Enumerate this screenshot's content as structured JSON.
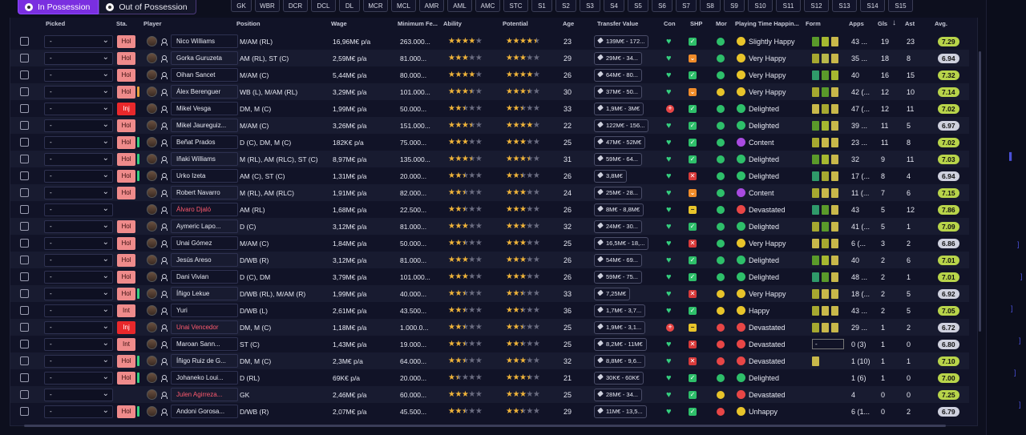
{
  "tabs": [
    {
      "label": "In Possession",
      "active": true
    },
    {
      "label": "Out of Possession",
      "active": false
    }
  ],
  "positions": [
    "GK",
    "WBR",
    "DCR",
    "DCL",
    "DL",
    "MCR",
    "MCL",
    "AMR",
    "AML",
    "AMC",
    "STC",
    "S1",
    "S2",
    "S3",
    "S4",
    "S5",
    "S6",
    "S7",
    "S8",
    "S9",
    "S10",
    "S11",
    "S12",
    "S13",
    "S14",
    "S15"
  ],
  "columns": {
    "picked": "Picked",
    "sta": "Sta.",
    "player": "Player",
    "position": "Position",
    "wage": "Wage",
    "minfee": "Minimum Fe...",
    "ability": "Ability",
    "potential": "Potential",
    "age": "Age",
    "tv": "Transfer Value",
    "con": "Con",
    "shp": "SHP",
    "mor": "Mor",
    "pth": "Playing Time Happin...",
    "form": "Form",
    "apps": "Apps",
    "gls": "Gls",
    "sort": "↓",
    "ast": "Ast",
    "avg": "Avg."
  },
  "colors": {
    "accent": "#7a2fe0",
    "badge": "#ef8b8b",
    "injured": "#e8282b",
    "star": "#f0b43a",
    "green": "#35d07f"
  },
  "players": [
    {
      "sel": "-",
      "sta": "Hol",
      "stripe": "",
      "name": "Nico Williams",
      "red": false,
      "pos": "M/AM (RL)",
      "wage": "16,96M€ p/a",
      "fee": "263.000...",
      "ab": 4,
      "pot": 4.5,
      "age": "23",
      "tv": "139M€ - 172...",
      "con": "heart",
      "shp": "ok",
      "mor": "#2ebf6a",
      "pth": "Slightly Happy",
      "face": "#e8c42a",
      "form": [
        "#5a9a2a",
        "#a6b830",
        "#c8b84a"
      ],
      "apps": "43 ...",
      "gls": "19",
      "ast": "23",
      "avg": "7.29",
      "avgc": "#b8d44a"
    },
    {
      "sel": "-",
      "sta": "Hol",
      "stripe": "",
      "name": "Gorka Guruzeta",
      "red": false,
      "pos": "AM (RL), ST (C)",
      "wage": "2,59M€ p/a",
      "fee": "81.000...",
      "ab": 3,
      "pot": 3,
      "age": "29",
      "tv": "29M€ - 34...",
      "con": "heart",
      "shp": "warn",
      "mor": "#2ebf6a",
      "pth": "Very Happy",
      "face": "#e8c42a",
      "form": [
        "#a6a830",
        "#b8b84a",
        "#c8b84a"
      ],
      "apps": "35 ...",
      "gls": "18",
      "ast": "8",
      "avg": "6.94",
      "avgc": "#cfd1de"
    },
    {
      "sel": "-",
      "sta": "Hol",
      "stripe": "",
      "name": "Oihan Sancet",
      "red": false,
      "pos": "M/AM (C)",
      "wage": "5,44M€ p/a",
      "fee": "80.000...",
      "ab": 4,
      "pot": 4,
      "age": "26",
      "tv": "64M€ - 80...",
      "con": "heart",
      "shp": "ok",
      "mor": "#2ebf6a",
      "pth": "Very Happy",
      "face": "#e8c42a",
      "form": [
        "#2f9a6a",
        "#5a9a2a",
        "#a6b830"
      ],
      "apps": "40",
      "gls": "16",
      "ast": "15",
      "avg": "7.32",
      "avgc": "#b8d44a"
    },
    {
      "sel": "-",
      "sta": "Hol",
      "stripe": "#e8a23a",
      "name": "Álex Berenguer",
      "red": false,
      "pos": "WB (L), M/AM (RL)",
      "wage": "3,29M€ p/a",
      "fee": "101.000...",
      "ab": 3.5,
      "pot": 3.5,
      "age": "30",
      "tv": "37M€ - 50...",
      "con": "heart",
      "shp": "warn",
      "mor": "#e8c42a",
      "pth": "Very Happy",
      "face": "#e8c42a",
      "form": [
        "#a6a830",
        "#5a9a2a",
        "#c8b84a"
      ],
      "apps": "42 (...",
      "gls": "12",
      "ast": "10",
      "avg": "7.14",
      "avgc": "#b8d44a"
    },
    {
      "sel": "-",
      "sta": "Inj",
      "stripe": "",
      "name": "Mikel Vesga",
      "red": false,
      "pos": "DM, M (C)",
      "wage": "1,99M€ p/a",
      "fee": "50.000...",
      "ab": 2.5,
      "pot": 2.5,
      "age": "33",
      "tv": "1,9M€ - 3M€",
      "con": "plus",
      "shp": "ok",
      "mor": "#2ebf6a",
      "pth": "Delighted",
      "face": "#2ebf6a",
      "form": [
        "#c8b84a",
        "#a6a830",
        "#c8b84a"
      ],
      "apps": "47 (...",
      "gls": "12",
      "ast": "11",
      "avg": "7.02",
      "avgc": "#b8d44a"
    },
    {
      "sel": "-",
      "sta": "Hol",
      "stripe": "",
      "name": "Mikel Jaureguiz...",
      "red": false,
      "pos": "M/AM (C)",
      "wage": "3,26M€ p/a",
      "fee": "151.000...",
      "ab": 3.5,
      "pot": 4,
      "age": "22",
      "tv": "122M€ - 156...",
      "con": "heart",
      "shp": "ok",
      "mor": "#2ebf6a",
      "pth": "Delighted",
      "face": "#2ebf6a",
      "form": [
        "#5a9a2a",
        "#a6b830",
        "#c8b84a"
      ],
      "apps": "39 ...",
      "gls": "11",
      "ast": "5",
      "avg": "6.97",
      "avgc": "#cfd1de"
    },
    {
      "sel": "-",
      "sta": "Hol",
      "stripe": "#35d07f",
      "name": "Beñat Prados",
      "red": false,
      "pos": "D (C), DM, M (C)",
      "wage": "182K€ p/a",
      "fee": "75.000...",
      "ab": 3,
      "pot": 3,
      "age": "25",
      "tv": "47M€ - 52M€",
      "con": "heart",
      "shp": "ok",
      "mor": "#2ebf6a",
      "pth": "Content",
      "face": "#a84ae0",
      "form": [
        "#a6a830",
        "#c8b84a",
        "#c8b84a"
      ],
      "apps": "23 ...",
      "gls": "11",
      "ast": "8",
      "avg": "7.02",
      "avgc": "#b8d44a"
    },
    {
      "sel": "-",
      "sta": "Hol",
      "stripe": "#35d07f",
      "name": "Iñaki Williams",
      "red": false,
      "pos": "M (RL), AM (RLC), ST (C)",
      "wage": "8,97M€ p/a",
      "fee": "135.000...",
      "ab": 3.5,
      "pot": 3.5,
      "age": "31",
      "tv": "59M€ - 64...",
      "con": "heart",
      "shp": "ok",
      "mor": "#2ebf6a",
      "pth": "Delighted",
      "face": "#2ebf6a",
      "form": [
        "#5a9a2a",
        "#a6b830",
        "#c8b84a"
      ],
      "apps": "32",
      "gls": "9",
      "ast": "11",
      "avg": "7.03",
      "avgc": "#b8d44a"
    },
    {
      "sel": "-",
      "sta": "Hol",
      "stripe": "#35d07f",
      "name": "Urko Izeta",
      "red": false,
      "pos": "AM (C), ST (C)",
      "wage": "1,31M€ p/a",
      "fee": "20.000...",
      "ab": 2.5,
      "pot": 2.5,
      "age": "26",
      "tv": "3,8M€",
      "con": "heart",
      "shp": "bad",
      "mor": "#2ebf6a",
      "pth": "Delighted",
      "face": "#2ebf6a",
      "form": [
        "#2f9a6a",
        "#a6a830",
        "#c8b84a"
      ],
      "apps": "17 (...",
      "gls": "8",
      "ast": "4",
      "avg": "6.94",
      "avgc": "#cfd1de"
    },
    {
      "sel": "-",
      "sta": "Hol",
      "stripe": "",
      "name": "Robert Navarro",
      "red": false,
      "pos": "M (RL), AM (RLC)",
      "wage": "1,91M€ p/a",
      "fee": "82.000...",
      "ab": 2.5,
      "pot": 3,
      "age": "24",
      "tv": "25M€ - 28...",
      "con": "heart",
      "shp": "warn",
      "mor": "#2ebf6a",
      "pth": "Content",
      "face": "#a84ae0",
      "form": [
        "#a6a830",
        "#c8b84a",
        "#c8b84a"
      ],
      "apps": "11 (...",
      "gls": "7",
      "ast": "6",
      "avg": "7.15",
      "avgc": "#b8d44a"
    },
    {
      "sel": "-",
      "sta": "",
      "stripe": "",
      "name": "Álvaro Djaló",
      "red": true,
      "pos": "AM (RL)",
      "wage": "1,68M€ p/a",
      "fee": "22.500...",
      "ab": 2.5,
      "pot": 3,
      "age": "26",
      "tv": "8M€ - 8,8M€",
      "con": "heart",
      "shp": "mid",
      "mor": "#2ebf6a",
      "pth": "Devastated",
      "face": "#e84646",
      "form": [
        "#2f9a6a",
        "#5a9a2a",
        "#c8b84a"
      ],
      "apps": "43",
      "gls": "5",
      "ast": "12",
      "avg": "7.86",
      "avgc": "#b8d44a"
    },
    {
      "sel": "-",
      "sta": "Hol",
      "stripe": "",
      "name": "Aymeric Lapo...",
      "red": false,
      "pos": "D (C)",
      "wage": "3,12M€ p/a",
      "fee": "81.000...",
      "ab": 3,
      "pot": 3,
      "age": "32",
      "tv": "24M€ - 30...",
      "con": "heart",
      "shp": "ok",
      "mor": "#2ebf6a",
      "pth": "Delighted",
      "face": "#2ebf6a",
      "form": [
        "#a6a830",
        "#5a9a2a",
        "#c8b84a"
      ],
      "apps": "41 (...",
      "gls": "5",
      "ast": "1",
      "avg": "7.09",
      "avgc": "#b8d44a"
    },
    {
      "sel": "-",
      "sta": "Hol",
      "stripe": "",
      "name": "Unai Gómez",
      "red": false,
      "pos": "M/AM (C)",
      "wage": "1,84M€ p/a",
      "fee": "50.000...",
      "ab": 2.5,
      "pot": 3,
      "age": "25",
      "tv": "16,5M€ - 18,...",
      "con": "heart",
      "shp": "bad",
      "mor": "#2ebf6a",
      "pth": "Very Happy",
      "face": "#e8c42a",
      "form": [
        "#c8b84a",
        "#a6a830",
        "#c8b84a"
      ],
      "apps": "6 (...",
      "gls": "3",
      "ast": "2",
      "avg": "6.86",
      "avgc": "#cfd1de"
    },
    {
      "sel": "-",
      "sta": "Hol",
      "stripe": "",
      "name": "Jesús Areso",
      "red": false,
      "pos": "D/WB (R)",
      "wage": "3,12M€ p/a",
      "fee": "81.000...",
      "ab": 3,
      "pot": 3,
      "age": "26",
      "tv": "54M€ - 69...",
      "con": "heart",
      "shp": "ok",
      "mor": "#2ebf6a",
      "pth": "Delighted",
      "face": "#2ebf6a",
      "form": [
        "#5a9a2a",
        "#a6b830",
        "#c8b84a"
      ],
      "apps": "40",
      "gls": "2",
      "ast": "6",
      "avg": "7.01",
      "avgc": "#b8d44a"
    },
    {
      "sel": "-",
      "sta": "Hol",
      "stripe": "",
      "name": "Dani Vivian",
      "red": false,
      "pos": "D (C), DM",
      "wage": "3,79M€ p/a",
      "fee": "101.000...",
      "ab": 3,
      "pot": 3,
      "age": "26",
      "tv": "59M€ - 75...",
      "con": "heart",
      "shp": "ok",
      "mor": "#2ebf6a",
      "pth": "Delighted",
      "face": "#2ebf6a",
      "form": [
        "#2f9a6a",
        "#5a9a2a",
        "#c8b84a"
      ],
      "apps": "48 ...",
      "gls": "2",
      "ast": "1",
      "avg": "7.01",
      "avgc": "#b8d44a"
    },
    {
      "sel": "-",
      "sta": "Hol",
      "stripe": "#35d07f",
      "name": "Íñigo Lekue",
      "red": false,
      "pos": "D/WB (RL), M/AM (R)",
      "wage": "1,99M€ p/a",
      "fee": "40.000...",
      "ab": 2.5,
      "pot": 2.5,
      "age": "33",
      "tv": "7,25M€",
      "con": "heart",
      "shp": "bad",
      "mor": "#e8c42a",
      "pth": "Very Happy",
      "face": "#e8c42a",
      "form": [
        "#a6a830",
        "#c8b84a",
        "#c8b84a"
      ],
      "apps": "18 (...",
      "gls": "2",
      "ast": "5",
      "avg": "6.92",
      "avgc": "#cfd1de"
    },
    {
      "sel": "-",
      "sta": "Int",
      "stripe": "",
      "name": "Yuri",
      "red": false,
      "pos": "D/WB (L)",
      "wage": "2,61M€ p/a",
      "fee": "43.500...",
      "ab": 2.5,
      "pot": 2.5,
      "age": "36",
      "tv": "1,7M€ - 3,7...",
      "con": "heart",
      "shp": "ok",
      "mor": "#e8c42a",
      "pth": "Happy",
      "face": "#e8c42a",
      "form": [
        "#a6a830",
        "#c8b84a",
        "#c8b84a"
      ],
      "apps": "43 ...",
      "gls": "2",
      "ast": "5",
      "avg": "7.05",
      "avgc": "#b8d44a"
    },
    {
      "sel": "-",
      "sta": "Inj",
      "stripe": "",
      "name": "Unai Vencedor",
      "red": true,
      "pos": "DM, M (C)",
      "wage": "1,18M€ p/a",
      "fee": "1.000.0...",
      "ab": 2.5,
      "pot": 2.5,
      "age": "25",
      "tv": "1,9M€ - 3,1...",
      "con": "plus",
      "shp": "mid",
      "mor": "#e84646",
      "pth": "Devastated",
      "face": "#e84646",
      "form": [
        "#a6a830",
        "#c8b84a",
        "#c8b84a"
      ],
      "apps": "29 ...",
      "gls": "1",
      "ast": "2",
      "avg": "6.72",
      "avgc": "#cfd1de"
    },
    {
      "sel": "-",
      "sta": "Int",
      "stripe": "",
      "name": "Maroan Sann...",
      "red": false,
      "pos": "ST (C)",
      "wage": "1,43M€ p/a",
      "fee": "19.000...",
      "ab": 2.5,
      "pot": 2.5,
      "age": "25",
      "tv": "8,2M€ - 11M€",
      "con": "heart",
      "shp": "bad",
      "mor": "#e84646",
      "pth": "Devastated",
      "face": "#e84646",
      "form": [
        "dash"
      ],
      "apps": "0 (3)",
      "gls": "1",
      "ast": "0",
      "avg": "6.80",
      "avgc": "#cfd1de"
    },
    {
      "sel": "-",
      "sta": "Hol",
      "stripe": "#35d07f",
      "name": "Íñigo Ruiz de G...",
      "red": false,
      "pos": "DM, M (C)",
      "wage": "2,3M€ p/a",
      "fee": "64.000...",
      "ab": 2.5,
      "pot": 3,
      "age": "32",
      "tv": "8,8M€ - 9,6...",
      "con": "heart",
      "shp": "bad",
      "mor": "#e84646",
      "pth": "Devastated",
      "face": "#e84646",
      "form": [
        "#c8b84a"
      ],
      "apps": "1 (10)",
      "gls": "1",
      "ast": "1",
      "avg": "7.10",
      "avgc": "#b8d44a"
    },
    {
      "sel": "-",
      "sta": "Hol",
      "stripe": "#35d07f",
      "name": "Johaneko Loui...",
      "red": false,
      "pos": "D (RL)",
      "wage": "69K€ p/a",
      "fee": "20.000...",
      "ab": 1.5,
      "pot": 3.5,
      "age": "21",
      "tv": "30K€ - 60K€",
      "con": "heart",
      "shp": "ok",
      "mor": "#2ebf6a",
      "pth": "Delighted",
      "face": "#2ebf6a",
      "form": [],
      "apps": "1 (6)",
      "gls": "1",
      "ast": "0",
      "avg": "7.00",
      "avgc": "#b8d44a"
    },
    {
      "sel": "-",
      "sta": "",
      "stripe": "",
      "name": "Julen Agirreza...",
      "red": true,
      "pos": "GK",
      "wage": "2,46M€ p/a",
      "fee": "60.000...",
      "ab": 3,
      "pot": 3,
      "age": "25",
      "tv": "28M€ - 34...",
      "con": "heart",
      "shp": "ok",
      "mor": "#e8c42a",
      "pth": "Devastated",
      "face": "#e84646",
      "form": [],
      "apps": "4",
      "gls": "0",
      "ast": "0",
      "avg": "7.25",
      "avgc": "#b8d44a"
    },
    {
      "sel": "-",
      "sta": "Hol",
      "stripe": "#35d07f",
      "name": "Andoni Gorosa...",
      "red": false,
      "pos": "D/WB (R)",
      "wage": "2,07M€ p/a",
      "fee": "45.500...",
      "ab": 2.5,
      "pot": 2.5,
      "age": "29",
      "tv": "11M€ - 13,5...",
      "con": "heart",
      "shp": "ok",
      "mor": "#e84646",
      "pth": "Unhappy",
      "face": "#e8c42a",
      "form": [],
      "apps": "6 (1...",
      "gls": "0",
      "ast": "2",
      "avg": "6.79",
      "avgc": "#cfd1de"
    }
  ]
}
